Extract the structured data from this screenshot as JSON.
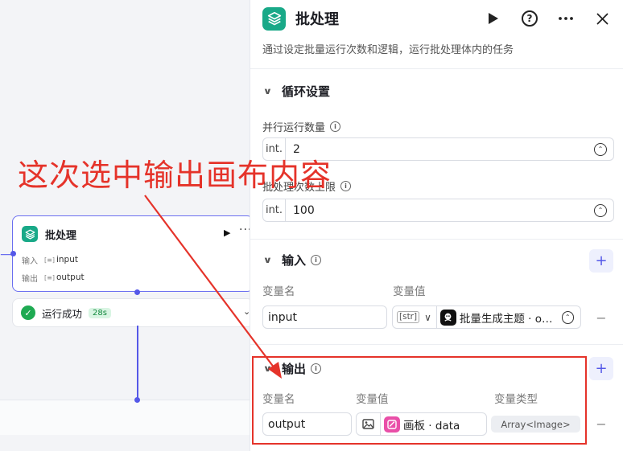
{
  "canvas": {
    "node": {
      "title": "批处理",
      "input_label": "输入",
      "input_value": "input",
      "output_label": "输出",
      "output_value": "output",
      "more": "···"
    },
    "run_status": {
      "text": "运行成功",
      "duration": "28s"
    }
  },
  "panel": {
    "title": "批处理",
    "description": "通过设定批量运行次数和逻辑，运行批处理体内的任务",
    "loop_section": {
      "title": "循环设置",
      "parallel_label": "并行运行数量",
      "parallel_type": "int.",
      "parallel_value": "2",
      "limit_label": "批处理次数上限",
      "limit_type": "int.",
      "limit_value": "100"
    },
    "input_section": {
      "title": "输入",
      "col_name": "变量名",
      "col_value": "变量值",
      "var_name": "input",
      "var_type_chip": "[str]",
      "var_ref": "批量生成主题 · o…"
    },
    "output_section": {
      "title": "输出",
      "col_name": "变量名",
      "col_value": "变量值",
      "col_type": "变量类型",
      "var_name": "output",
      "var_ref": "画板 · data",
      "var_type": "Array<Image>"
    }
  },
  "annotation": {
    "text": "这次选中输出画布内容",
    "color": "#e5332a"
  },
  "colors": {
    "accent": "#5458e8",
    "node_green": "#19a988",
    "success": "#1eaa52",
    "board_pink": "#e94fa8"
  }
}
